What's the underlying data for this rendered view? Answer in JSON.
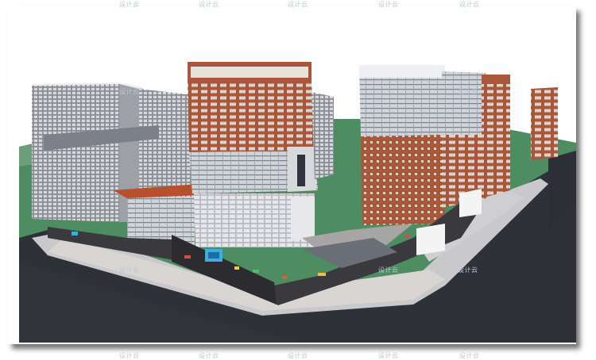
{
  "image": {
    "kind": "3d-architectural-model-render",
    "watermark_text": "设计云",
    "colors": {
      "ground": "#4e8c62",
      "road": "#2e3238",
      "sidewalk": "#c9c9cb",
      "plaza": "#d9d5d2",
      "brick": "#a9563a",
      "glass": "#c8ccd4",
      "podium": "#3a3a3e",
      "roof_canopy": "#b8502e"
    }
  }
}
